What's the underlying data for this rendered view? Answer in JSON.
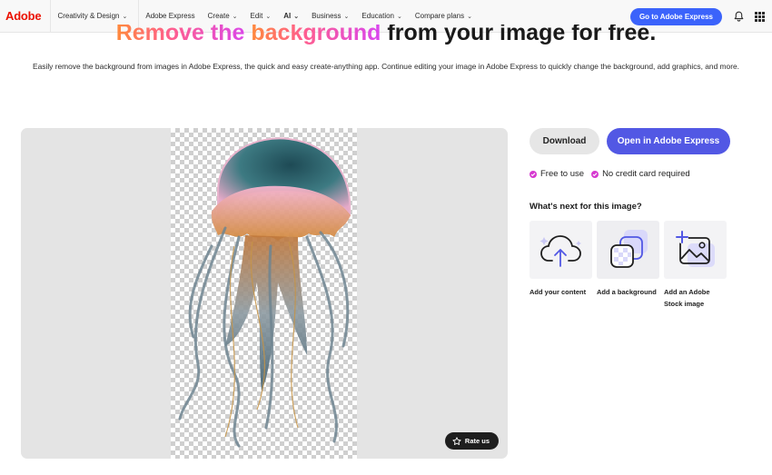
{
  "nav": {
    "logo": "Adobe",
    "items": [
      {
        "label": "Creativity & Design",
        "dropdown": true
      },
      {
        "label": "Adobe Express",
        "dropdown": false
      },
      {
        "label": "Create",
        "dropdown": true
      },
      {
        "label": "Edit",
        "dropdown": true
      },
      {
        "label": "AI",
        "dropdown": true,
        "active": true
      },
      {
        "label": "Business",
        "dropdown": true
      },
      {
        "label": "Education",
        "dropdown": true
      },
      {
        "label": "Compare plans",
        "dropdown": true
      }
    ],
    "cta_label": "Go to Adobe Express",
    "icons": [
      "bell-icon",
      "app-grid-icon"
    ],
    "chevron_glyph": "⌄"
  },
  "hero": {
    "title_highlight_1": "Remove the ",
    "title_highlight_2": "background",
    "title_rest": " from your image for free.",
    "subtitle": "Easily remove the background from images in Adobe Express, the quick and easy create-anything app. Continue editing your image in Adobe Express to quickly change the background, add graphics, and more."
  },
  "preview": {
    "image_subject": "jellyfish with transparent background",
    "rate_label": "Rate us"
  },
  "actions": {
    "download_label": "Download",
    "open_label": "Open in Adobe Express",
    "perks": [
      "Free to use",
      "No credit card required"
    ],
    "next_title": "What's next for this image?",
    "cards": [
      {
        "label": "Add your content",
        "icon": "cloud-upload-icon"
      },
      {
        "label": "Add a background",
        "icon": "background-layers-icon"
      },
      {
        "label": "Add an Adobe Stock image",
        "icon": "add-image-icon"
      }
    ]
  },
  "colors": {
    "adobe_red": "#eb1000",
    "cta_blue": "#3b63fb",
    "open_purple": "#5258e4",
    "perk_pink": "#d63ad0",
    "title_gradient": [
      "#ff8a3c",
      "#ff5f8d",
      "#d946ef"
    ]
  }
}
